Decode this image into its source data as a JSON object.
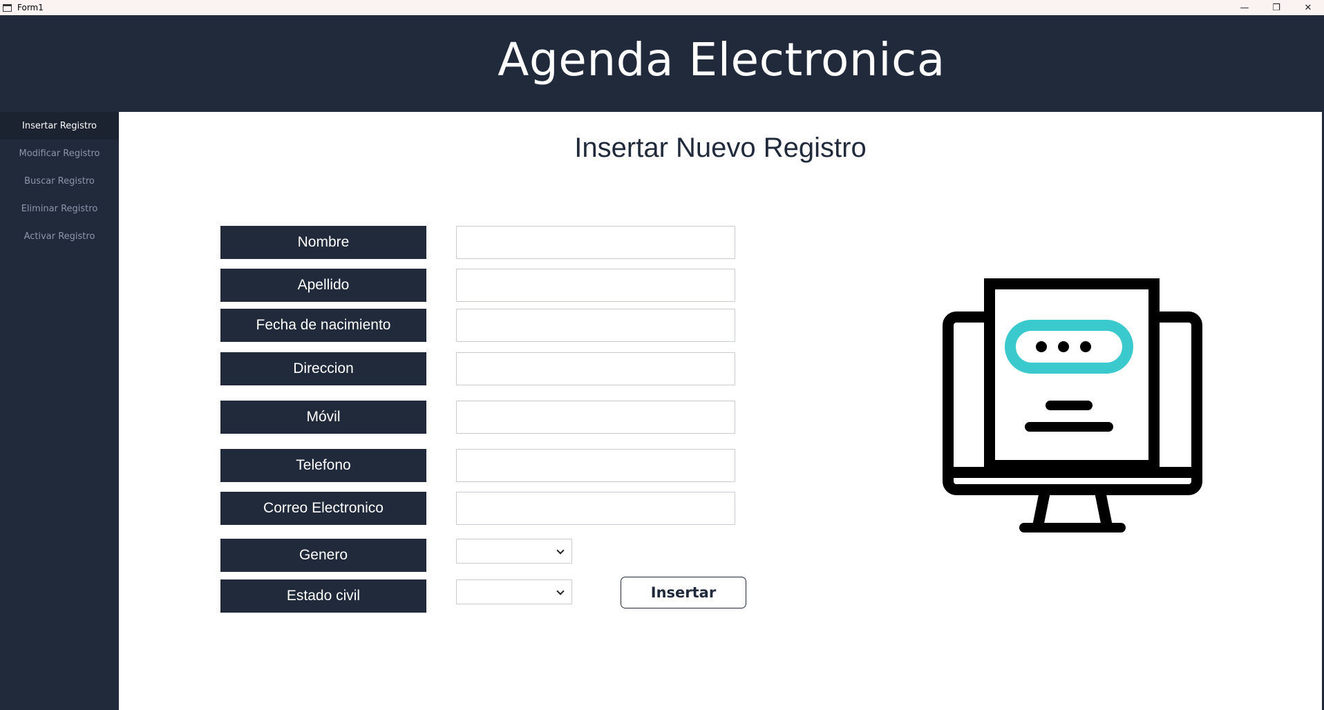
{
  "window": {
    "title": "Form1",
    "minimize_glyph": "—",
    "maximize_glyph": "❐",
    "close_glyph": "✕"
  },
  "header": {
    "title": "Agenda Electronica"
  },
  "sidebar": {
    "items": [
      {
        "label": "Insertar Registro",
        "active": true
      },
      {
        "label": "Modificar Registro"
      },
      {
        "label": "Buscar Registro"
      },
      {
        "label": "Eliminar Registro"
      },
      {
        "label": "Activar Registro"
      }
    ]
  },
  "main": {
    "title": "Insertar Nuevo Registro",
    "fields": {
      "nombre": {
        "label": "Nombre",
        "value": ""
      },
      "apellido": {
        "label": "Apellido",
        "value": ""
      },
      "fecha": {
        "label": "Fecha de nacimiento",
        "value": ""
      },
      "direccion": {
        "label": "Direccion",
        "value": ""
      },
      "movil": {
        "label": "Móvil",
        "value": ""
      },
      "telefono": {
        "label": "Telefono",
        "value": ""
      },
      "correo": {
        "label": "Correo Electronico",
        "value": ""
      },
      "genero": {
        "label": "Genero",
        "selected": ""
      },
      "estado_civil": {
        "label": "Estado civil",
        "selected": ""
      }
    },
    "submit_label": "Insertar",
    "illustration_icon": "computer-chat-icon"
  },
  "colors": {
    "navy": "#212a3b",
    "accent_teal": "#3ac9cc",
    "titlebar": "#faf3f1",
    "sidebar_inactive_text": "#8d96a8"
  }
}
